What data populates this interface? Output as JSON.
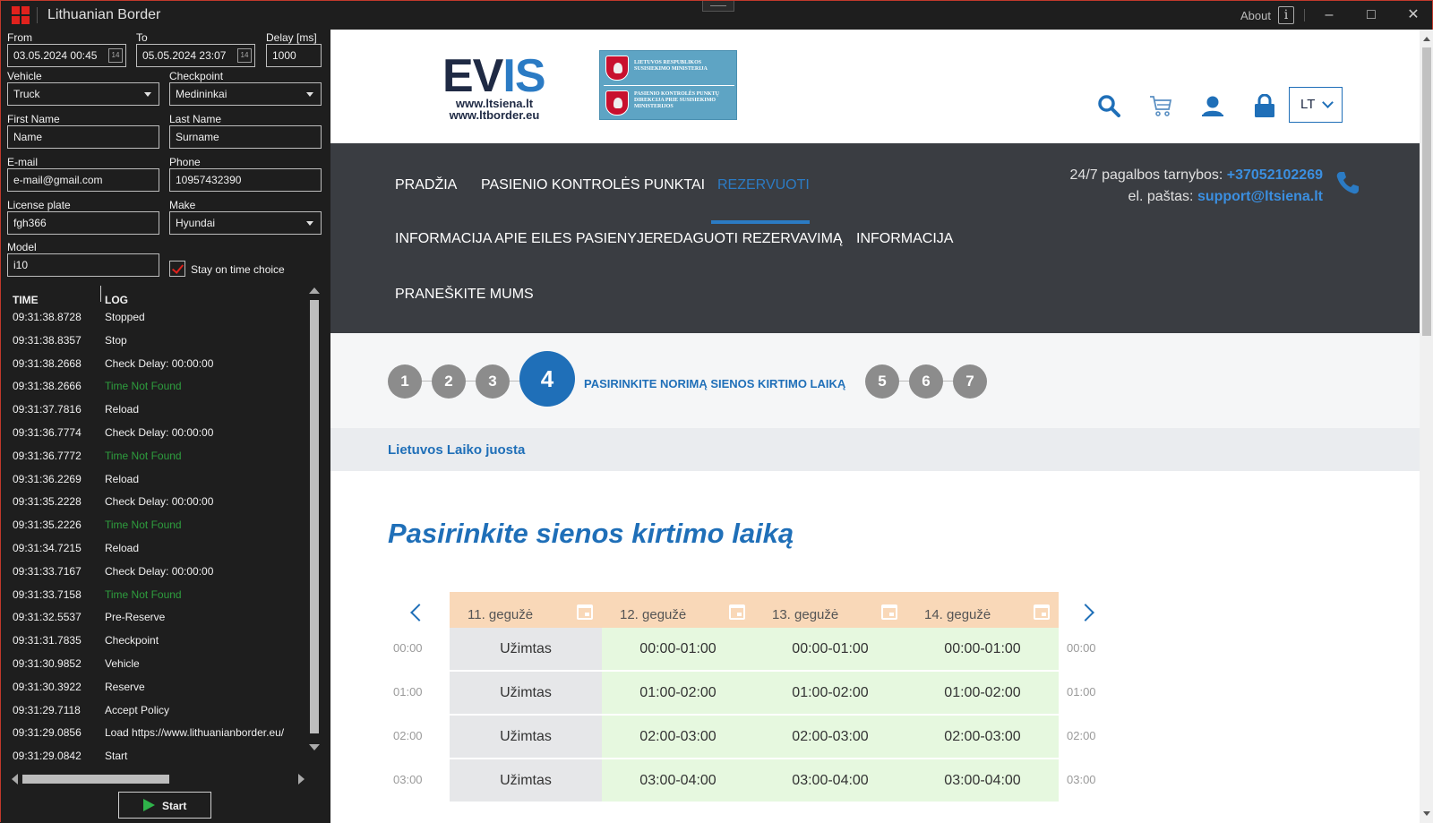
{
  "window": {
    "title": "Lithuanian Border",
    "about_label": "About",
    "about_icon": "i"
  },
  "form": {
    "from_label": "From",
    "from_value": "03.05.2024 00:45",
    "to_label": "To",
    "to_value": "05.05.2024 23:07",
    "delay_label": "Delay [ms]",
    "delay_value": "1000",
    "vehicle_label": "Vehicle",
    "vehicle_value": "Truck",
    "checkpoint_label": "Checkpoint",
    "checkpoint_value": "Medininkai",
    "first_name_label": "First Name",
    "first_name_value": "Name",
    "last_name_label": "Last Name",
    "last_name_value": "Surname",
    "email_label": "E-mail",
    "email_value": "e-mail@gmail.com",
    "phone_label": "Phone",
    "phone_value": "10957432390",
    "plate_label": "License plate",
    "plate_value": "fgh366",
    "make_label": "Make",
    "make_value": "Hyundai",
    "model_label": "Model",
    "model_value": "i10",
    "stay_label": "Stay on time choice",
    "stay_checked": true
  },
  "log": {
    "time_header": "TIME",
    "log_header": "LOG",
    "rows": [
      {
        "time": "09:31:38.8728",
        "msg": "Stopped",
        "green": false
      },
      {
        "time": "09:31:38.8357",
        "msg": "Stop",
        "green": false
      },
      {
        "time": "09:31:38.2668",
        "msg": "Check Delay: 00:00:00",
        "green": false
      },
      {
        "time": "09:31:38.2666",
        "msg": "Time Not Found",
        "green": true
      },
      {
        "time": "09:31:37.7816",
        "msg": "Reload",
        "green": false
      },
      {
        "time": "09:31:36.7774",
        "msg": "Check Delay: 00:00:00",
        "green": false
      },
      {
        "time": "09:31:36.7772",
        "msg": "Time Not Found",
        "green": true
      },
      {
        "time": "09:31:36.2269",
        "msg": "Reload",
        "green": false
      },
      {
        "time": "09:31:35.2228",
        "msg": "Check Delay: 00:00:00",
        "green": false
      },
      {
        "time": "09:31:35.2226",
        "msg": "Time Not Found",
        "green": true
      },
      {
        "time": "09:31:34.7215",
        "msg": "Reload",
        "green": false
      },
      {
        "time": "09:31:33.7167",
        "msg": "Check Delay: 00:00:00",
        "green": false
      },
      {
        "time": "09:31:33.7158",
        "msg": "Time Not Found",
        "green": true
      },
      {
        "time": "09:31:32.5537",
        "msg": "Pre-Reserve",
        "green": false
      },
      {
        "time": "09:31:31.7835",
        "msg": "Checkpoint",
        "green": false
      },
      {
        "time": "09:31:30.9852",
        "msg": "Vehicle",
        "green": false
      },
      {
        "time": "09:31:30.3922",
        "msg": "Reserve",
        "green": false
      },
      {
        "time": "09:31:29.7118",
        "msg": "Accept Policy",
        "green": false
      },
      {
        "time": "09:31:29.0856",
        "msg": "Load https://www.lithuanianborder.eu/",
        "green": false
      },
      {
        "time": "09:31:29.0842",
        "msg": "Start",
        "green": false
      }
    ]
  },
  "start_label": "Start",
  "site": {
    "logo_main": "EV",
    "logo_accent": "IS",
    "logo_url1": "www.ltsiena.lt",
    "logo_url2": "www.ltborder.eu",
    "ministry_line1": "LIETUVOS RESPUBLIKOS SUSISIEKIMO MINISTERIJA",
    "ministry_line2": "PASIENIO KONTROLĖS PUNKTŲ DIREKCIJA PRIE SUSISIEKIMO MINISTERIJOS",
    "lang": "LT",
    "nav": {
      "home": "PRADŽIA",
      "checkpoints": "PASIENIO KONTROLĖS PUNKTAI",
      "reserve": "REZERVUOTI",
      "queue_info": "INFORMACIJA APIE EILES PASIENYJE",
      "edit": "REDAGUOTI REZERVAVIMĄ",
      "info": "INFORMACIJA",
      "report": "PRANEŠKITE MUMS"
    },
    "help_prefix": "24/7 pagalbos tarnybos:",
    "help_phone": "+37052102269",
    "email_prefix": "el. paštas:",
    "help_email": "support@ltsiena.lt",
    "steps": [
      "1",
      "2",
      "3",
      "4",
      "5",
      "6",
      "7"
    ],
    "active_step_label": "PASIRINKITE NORIMĄ SIENOS KIRTIMO LAIKĄ",
    "zone": "Lietuvos Laiko juosta",
    "heading": "Pasirinkite sienos kirtimo laiką",
    "days": [
      "11. gegužė",
      "12. gegužė",
      "13. gegužė",
      "14. gegužė"
    ],
    "hours": [
      "00:00",
      "01:00",
      "02:00",
      "03:00"
    ],
    "busy_label": "Užimtas",
    "slots": [
      "00:00-01:00",
      "01:00-02:00",
      "02:00-03:00",
      "03:00-04:00"
    ]
  },
  "colors": {
    "accent": "#1f6fb8",
    "nav_bg": "#3a3d42",
    "day_header": "#f9d8b8",
    "free_slot": "#e6f8df",
    "busy_slot": "#e6e7e9",
    "log_green": "#2e9e3e"
  }
}
